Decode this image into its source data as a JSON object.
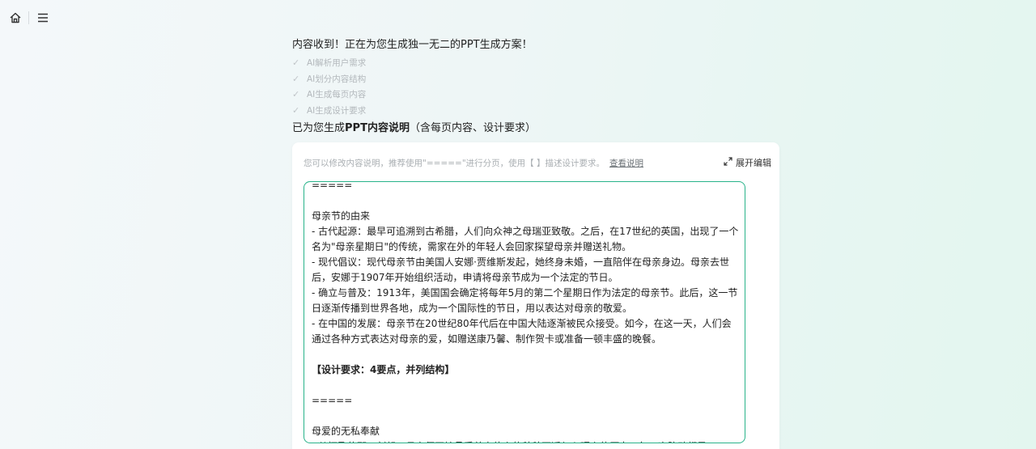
{
  "topbar": {
    "home_icon": "home-icon",
    "menu_icon": "hamburger-menu-icon"
  },
  "chat": {
    "message": "内容收到！正在为您生成独一无二的PPT生成方案！",
    "steps": [
      "AI解析用户需求",
      "AI划分内容结构",
      "AI生成每页内容",
      "AI生成设计要求"
    ],
    "generated_prefix": "已为您生成",
    "generated_bold": "PPT内容说明",
    "generated_suffix": "（含每页内容、设计要求）"
  },
  "card": {
    "hint": "您可以修改内容说明，推荐使用\"=====\"进行分页，使用【 】描述设计要求。",
    "hint_link": "查看说明",
    "expand_label": "展开编辑",
    "expand_icon": "expand-arrows-icon"
  },
  "editor": {
    "lines": [
      {
        "text": "=====",
        "bold": false
      },
      {
        "text": "",
        "bold": false
      },
      {
        "text": "母亲节的由来",
        "bold": false
      },
      {
        "text": "- 古代起源：最早可追溯到古希腊，人们向众神之母瑞亚致敬。之后，在17世纪的英国，出现了一个",
        "bold": false
      },
      {
        "text": "名为\"母亲星期日\"的传统，需家在外的年轻人会回家探望母亲并赠送礼物。",
        "bold": false
      },
      {
        "text": "- 现代倡议：现代母亲节由美国人安娜·贾维斯发起，她终身未婚，一直陪伴在母亲身边。母亲去世",
        "bold": false
      },
      {
        "text": "后，安娜于1907年开始组织活动，申请将母亲节成为一个法定的节日。",
        "bold": false
      },
      {
        "text": "- 确立与普及：1913年，美国国会确定将每年5月的第二个星期日作为法定的母亲节。此后，这一节",
        "bold": false
      },
      {
        "text": "日逐渐传播到世界各地，成为一个国际性的节日，用以表达对母亲的敬爱。",
        "bold": false
      },
      {
        "text": "- 在中国的发展：母亲节在20世纪80年代后在中国大陆逐渐被民众接受。如今，在这一天，人们会",
        "bold": false
      },
      {
        "text": "通过各种方式表达对母亲的爱，如赠送康乃馨、制作贺卡或准备一顿丰盛的晚餐。",
        "bold": false
      },
      {
        "text": "",
        "bold": false
      },
      {
        "text": "【设计要求：4要点，并列结构】",
        "bold": true
      },
      {
        "text": "",
        "bold": false
      },
      {
        "text": "=====",
        "bold": false
      },
      {
        "text": "",
        "bold": false
      },
      {
        "text": "母爱的无私奉献",
        "bold": false
      },
      {
        "text": "- 从怀孕的那一刻起，母亲便开始承受着身体上的种种不适与心理上的压力。每一次胎动都是",
        "bold": false
      }
    ]
  },
  "colors": {
    "accent": "#29b38a",
    "muted": "#b3b8bc"
  }
}
